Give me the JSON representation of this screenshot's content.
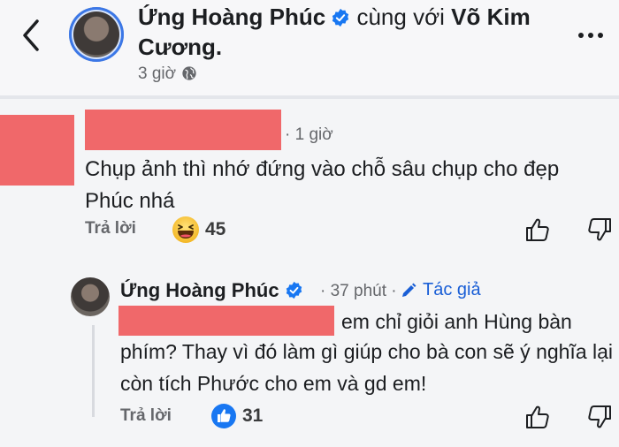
{
  "post": {
    "author": "Ứng Hoàng Phúc",
    "with_text": "cùng với",
    "tagged_first": "Võ Kim",
    "tagged_second": "Cương.",
    "time": "3 giờ"
  },
  "comments": [
    {
      "time": "· 1 giờ",
      "text": "Chụp ảnh thì nhớ đứng vào chỗ sâu chụp cho đẹp Phúc nhá",
      "reply_label": "Trả lời",
      "reaction_count": "45"
    }
  ],
  "reply": {
    "author": "Ứng Hoàng Phúc",
    "time": "· 37 phút ·",
    "author_badge": "Tác giả",
    "text_first": "em chỉ giỏi anh Hùng bàn",
    "text_rest": "phím? Thay vì đó làm gì giúp cho bà con sẽ ý nghĩa lại còn tích Phước cho em và gd em!",
    "reply_label": "Trả lời",
    "reaction_count": "31"
  },
  "colors": {
    "accent": "#1877f2",
    "redaction": "#f0686a",
    "muted": "#65676b"
  },
  "icons": [
    "back-arrow-icon",
    "verified-badge-icon",
    "globe-icon",
    "more-icon",
    "haha-reaction-icon",
    "like-reaction-icon",
    "thumbs-up-icon",
    "thumbs-down-icon",
    "pencil-icon"
  ]
}
